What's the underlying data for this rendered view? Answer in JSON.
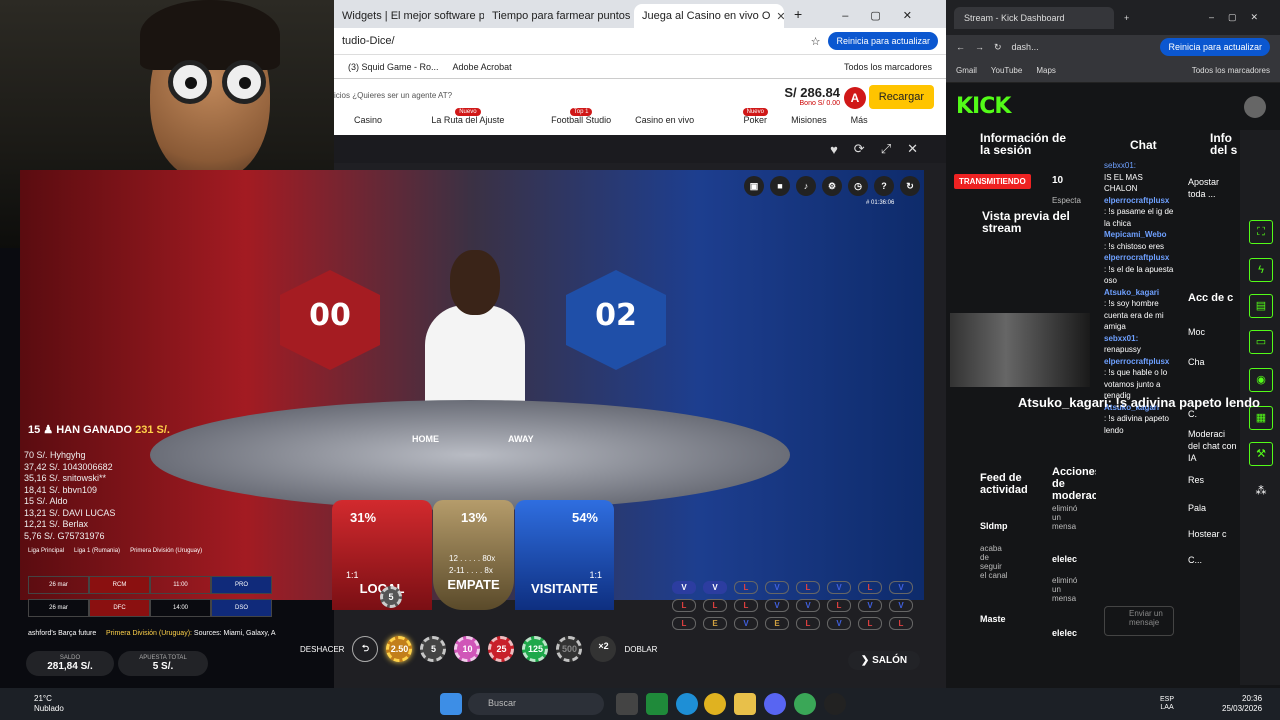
{
  "browser": {
    "tabs": [
      {
        "label": "Widgets | El mejor software p"
      },
      {
        "label": "Tiempo para farmear puntos"
      },
      {
        "label": "Juega al Casino en vivo O"
      }
    ],
    "url": "tudio-Dice/",
    "update_button": "Reinicia para actualizar",
    "bookmarks": [
      "(3) Squid Game - Ro...",
      "Adobe Acrobat",
      "Todos los marcadores"
    ]
  },
  "site": {
    "top_text": "icios  ¿Quieres ser un agente AT?",
    "balance": "S/ 286.84",
    "bonus": "Bono S/ 0.00",
    "avatar_letter": "A",
    "recharge_button": "Recargar",
    "nav": [
      {
        "label": "Casino",
        "badge": ""
      },
      {
        "label": "La Ruta del Ajuste",
        "badge": "Nuevo"
      },
      {
        "label": "Football Studio",
        "badge": "Top 1"
      },
      {
        "label": "Casino en vivo",
        "badge": ""
      },
      {
        "label": "Poker",
        "badge": "Nuevo"
      },
      {
        "label": "Misiones",
        "badge": ""
      },
      {
        "label": "Más",
        "badge": ""
      }
    ]
  },
  "game": {
    "timer": "# 01:36:06",
    "home_score": "00",
    "away_score": "02",
    "home_label": "HOME",
    "away_label": "AWAY",
    "winners": {
      "count": "15",
      "text": "HAN GANADO",
      "amount": "231 S/."
    },
    "winner_list": [
      "70 S/. Hyhgyhg",
      "37,42 S/. 1043006682",
      "35,16 S/. snitowski**",
      "18,41 S/. bbvn109",
      "15 S/. Aldo",
      "13,21 S/. DAVI LUCAS",
      "12,21 S/. Berlax",
      "5,76 S/. G75731976"
    ],
    "leagues": [
      "Liga Principal",
      "Liga 1 (Rumania)",
      "Primera División (Uruguay)"
    ],
    "fixtures": [
      {
        "date": "26 mar",
        "home": "RCM",
        "time": "11:00",
        "away": "PRO"
      },
      {
        "date": "26 mar",
        "home": "DFC",
        "time": "14:00",
        "away": "DSO"
      }
    ],
    "ticker": "ashford's Barça future",
    "ticker_league": "Primera División (Uruguay):",
    "ticker_sources": "Sources: Miami, Galaxy, A",
    "bets": {
      "local": {
        "pct": "31%",
        "payout": "1:1",
        "name": "LOCAL"
      },
      "draw": {
        "pct": "13%",
        "payout1": "12 . . . . . 80x",
        "payout2": "2-11 . . . . 8x",
        "name": "EMPATE"
      },
      "away": {
        "pct": "54%",
        "payout": "1:1",
        "name": "VISITANTE"
      }
    },
    "local_chip": "5",
    "roadmap": [
      [
        "V",
        "V",
        "L",
        "V",
        "L",
        "V",
        "L",
        "V"
      ],
      [
        "L",
        "L",
        "L",
        "V",
        "V",
        "L",
        "V",
        "V"
      ],
      [
        "L",
        "E",
        "V",
        "E",
        "L",
        "V",
        "L",
        "L"
      ]
    ],
    "undo_label": "DESHACER",
    "chips": [
      "2.50",
      "5",
      "10",
      "25",
      "125",
      "500"
    ],
    "double_multiplier": "×2",
    "double_label": "DOBLAR",
    "lobby_label": "SALÓN",
    "balance_label": "SALDO",
    "balance_value": "281,84 S/.",
    "total_bet_label": "APUESTA TOTAL",
    "total_bet_value": "5 S/."
  },
  "kick": {
    "tab_title": "Stream - Kick Dashboard",
    "url": "dash...",
    "update_button": "Reinicia para actualizar",
    "bookmarks": [
      "Gmail",
      "YouTube",
      "Maps",
      "Todos los marcadores"
    ],
    "logo": "KICK",
    "session_title": "Información de la sesión",
    "live_badge": "TRANSMITIENDO",
    "viewers": "10",
    "viewers_label": "Especta",
    "preview_title": "Vista previa del stream",
    "chat_title": "Chat",
    "info_title": "Info del s",
    "chat": [
      {
        "user": "sebxx01:",
        "text": "IS EL MAS CHALON"
      },
      {
        "user": "elperrocraftplusx",
        "text": ": !s pasame el ig de la chica"
      },
      {
        "user": "Mepicami_Webo",
        "text": ": !s chistoso eres"
      },
      {
        "user": "elperrocraftplusx",
        "text": ": !s el de la apuesta oso"
      },
      {
        "user": "Atsuko_kagari",
        "text": ": !s soy hombre"
      },
      {
        "user": "",
        "text": "cuenta era de mi amiga"
      },
      {
        "user": "sebxx01:",
        "text": "renapussy"
      },
      {
        "user": "elperrocraftplusx",
        "text": ": !s que hable o lo votamos junto a renadig"
      },
      {
        "user": "Atsuko_kagari",
        "text": ": !s adivina papeto lendo"
      }
    ],
    "overlay_user": "Atsuko_kagari",
    "overlay_text": ": !s adivina papeto lendo",
    "send_placeholder": "Enviar un mensaje",
    "feed_title": "Feed de actividad",
    "mod_actions_title": "Acciones de moderación",
    "feed": [
      {
        "user": "Sldmp",
        "text": "acaba de seguir el canal"
      },
      {
        "user": "Maste",
        "text": ""
      }
    ],
    "mod_actions": [
      {
        "user": "elelec",
        "text": "eliminó un mensa"
      },
      {
        "user": "elelec",
        "text": "eliminó un mensa"
      },
      {
        "user": "elelec",
        "text": ""
      }
    ],
    "info_side": [
      {
        "label": "Apostar toda ..."
      },
      {
        "label": "Acc de c"
      },
      {
        "label": "Moc"
      },
      {
        "label": "Cha"
      },
      {
        "label": "C."
      },
      {
        "label": "Moderaci del chat con IA"
      },
      {
        "label": "Res"
      },
      {
        "label": "Pala"
      },
      {
        "label": "Hostear c"
      },
      {
        "label": "C..."
      }
    ]
  },
  "taskbar": {
    "weather_temp": "21°C",
    "weather_text": "Nublado",
    "search_placeholder": "Buscar",
    "lang": "ESP",
    "lang2": "LAA",
    "time": "20:36",
    "date": "25/03/2026"
  }
}
